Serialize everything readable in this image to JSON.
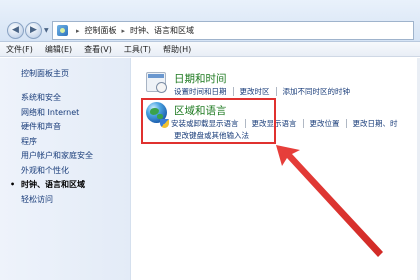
{
  "address": {
    "crumbs": [
      "控制面板",
      "时钟、语言和区域"
    ],
    "separator": "▸"
  },
  "menu": [
    "文件(F)",
    "编辑(E)",
    "查看(V)",
    "工具(T)",
    "帮助(H)"
  ],
  "sidebar": {
    "home": "控制面板主页",
    "items": [
      {
        "label": "系统和安全"
      },
      {
        "label": "网络和 Internet"
      },
      {
        "label": "硬件和声音"
      },
      {
        "label": "程序"
      },
      {
        "label": "用户帐户和家庭安全"
      },
      {
        "label": "外观和个性化"
      },
      {
        "label": "时钟、语言和区域",
        "current": true
      },
      {
        "label": "轻松访问"
      }
    ]
  },
  "main": {
    "date_time": {
      "title": "日期和时间",
      "links": [
        "设置时间和日期",
        "更改时区",
        "添加不同时区的时钟"
      ]
    },
    "region": {
      "title": "区域和语言",
      "links_row1": [
        "安装或卸载显示语言",
        "更改显示语言",
        "更改位置",
        "更改日期、时"
      ],
      "links_row2": [
        "更改键盘或其他输入法"
      ]
    }
  },
  "annotation": {
    "color": "#e0312f"
  }
}
